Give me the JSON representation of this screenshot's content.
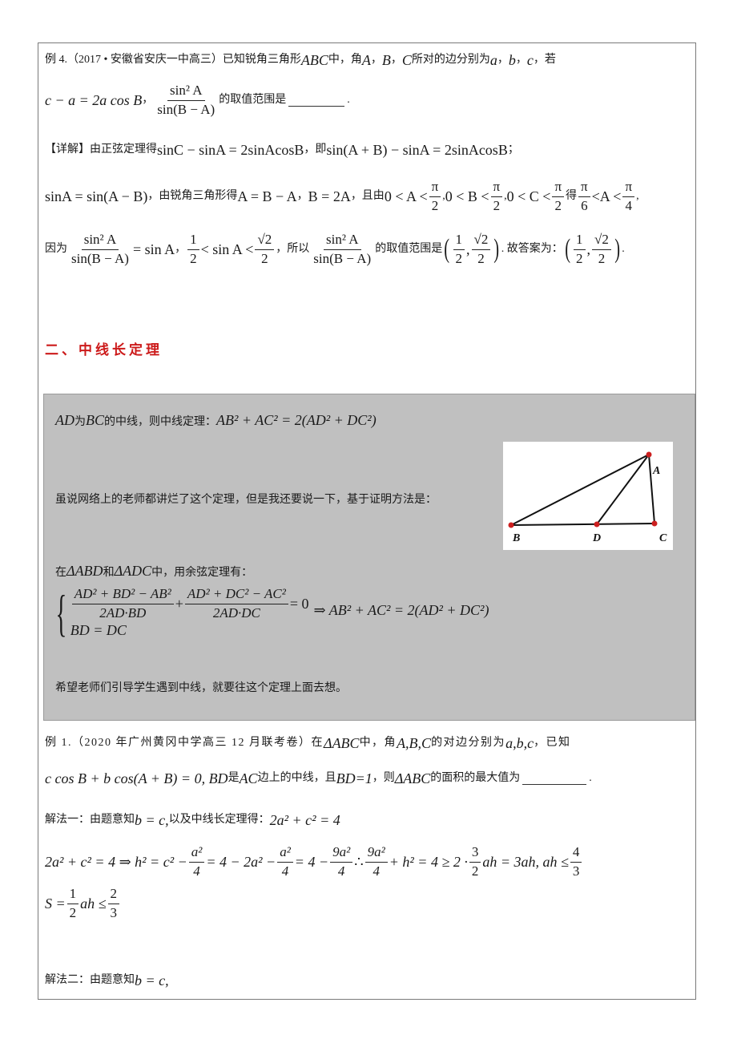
{
  "example4": {
    "label": "例 4.（2017 • 安徽省安庆一中高三）已知锐角三角形",
    "abc": "ABC",
    "mid1": " 中，角",
    "A": "A",
    "sep1": "，",
    "B": "B",
    "sep2": "，",
    "C": "C",
    "mid2": " 所对的边分别为",
    "a": "a",
    "sep3": "，",
    "b": "b",
    "sep4": "，",
    "c": "c",
    "end": "，若",
    "cond": "c − a = 2a cos B",
    "comma": "，",
    "frac_num": "sin² A",
    "frac_den": "sin(B − A)",
    "question": "的取值范围是",
    "period": "."
  },
  "solution": {
    "label": "【详解】",
    "line1_cn1": "由正弦定理得",
    "line1_eq1": "sinC − sinA = 2sinAcosB",
    "line1_cn2": "，即",
    "line1_eq2": "sin(A + B) − sinA = 2sinAcosB",
    "line1_end": "；",
    "line2_eq1": "sinA = sin(A − B)",
    "line2_cn1": "，由锐角三角形得",
    "line2_eq2": "A = B − A",
    "line2_sep": "，",
    "line2_eq3": "B = 2A",
    "line2_cn2": "，且由",
    "line2_c1": "0 < A <",
    "line2_c2": "0 < B <",
    "line2_c3": "0 < C <",
    "pi": "π",
    "two": "2",
    "six": "6",
    "four": "4",
    "line2_cn3": "得",
    "line2_r1": "<",
    "line2_r2": "A <",
    "line3_cn1": "因为",
    "line3_eq1": "= sin A",
    "line3_sep": "，",
    "one": "1",
    "line3_mid": "< sin A <",
    "sqrt2": "√2",
    "line3_cn2": "，所以",
    "line3_cn3": "的取值范围是",
    "line3_cn4": ". 故答案为：",
    "comma": ",",
    "end": "."
  },
  "section2": {
    "title": "二、中线长定理"
  },
  "median_box": {
    "line1_AD": "AD",
    "line1_cn1": "为",
    "line1_BC": "BC",
    "line1_cn2": "的中线，则中线定理：",
    "line1_eq": "AB² + AC² = 2(AD² + DC²)",
    "line2": "虽说网络上的老师都讲烂了这个定理，但是我还要说一下，基于证明方法是：",
    "line3_cn1": "在",
    "line3_t1": "ΔABD",
    "line3_cn2": "和",
    "line3_t2": "ΔADC",
    "line3_cn3": "中，用余弦定理有：",
    "sys_num1": "AD² + BD² − AB²",
    "sys_den1": "2AD·BD",
    "sys_plus": "+",
    "sys_num2": "AD² + DC² − AC²",
    "sys_den2": "2AD·DC",
    "sys_eq0": "= 0",
    "sys_implies": "⇒ AB² + AC² = 2(AD² + DC²)",
    "sys_line2": "BD = DC",
    "line4": "希望老师们引导学生遇到中线，就要往这个定理上面去想。",
    "figure": {
      "labels": {
        "A": "A",
        "B": "B",
        "C": "C",
        "D": "D"
      },
      "point_color": "#cc1f1f",
      "line_color": "#111111"
    }
  },
  "example1": {
    "line1_cn1": "例 1.（2020 年广州黄冈中学高三 12 月联考卷）在",
    "line1_t": "ΔABC",
    "line1_cn2": "中，角",
    "line1_angles": "A,B,C",
    "line1_cn3": "的对边分别为",
    "line1_sides": "a,b,c",
    "line1_cn4": "，已知",
    "line2_eq1": "c cos B + b cos(A + B) = 0, BD",
    "line2_cn1": "是",
    "line2_AC": "AC",
    "line2_cn2": "边上的中线，且",
    "line2_eq2": "BD=1",
    "line2_cn3": "，则",
    "line2_t": "ΔABC",
    "line2_cn4": "的面积的最大值为",
    "line2_end": ".",
    "method1_cn1": "解法一：由题意知",
    "method1_eq1": "b = c,",
    "method1_cn2": "以及中线长定理得：",
    "method1_eq2": "2a² + c² = 4",
    "deriv_a": "2a² + c² = 4 ⇒ h² = c² −",
    "deriv_f1n": "a²",
    "deriv_f1d": "4",
    "deriv_b": "= 4 − 2a² −",
    "deriv_c": "= 4 −",
    "deriv_f3n": "9a²",
    "deriv_d": "∴",
    "deriv_e": "+ h² = 4 ≥ 2 ·",
    "deriv_f5n": "3",
    "deriv_f5d": "2",
    "deriv_f": "ah = 3ah, ah ≤",
    "deriv_f6n": "4",
    "deriv_f6d": "3",
    "area_a": "S =",
    "area_f1n": "1",
    "area_f1d": "2",
    "area_b": "ah ≤",
    "area_f2n": "2",
    "area_f2d": "3",
    "method2_cn": "解法二：由题意知",
    "method2_eq": "b = c,"
  }
}
